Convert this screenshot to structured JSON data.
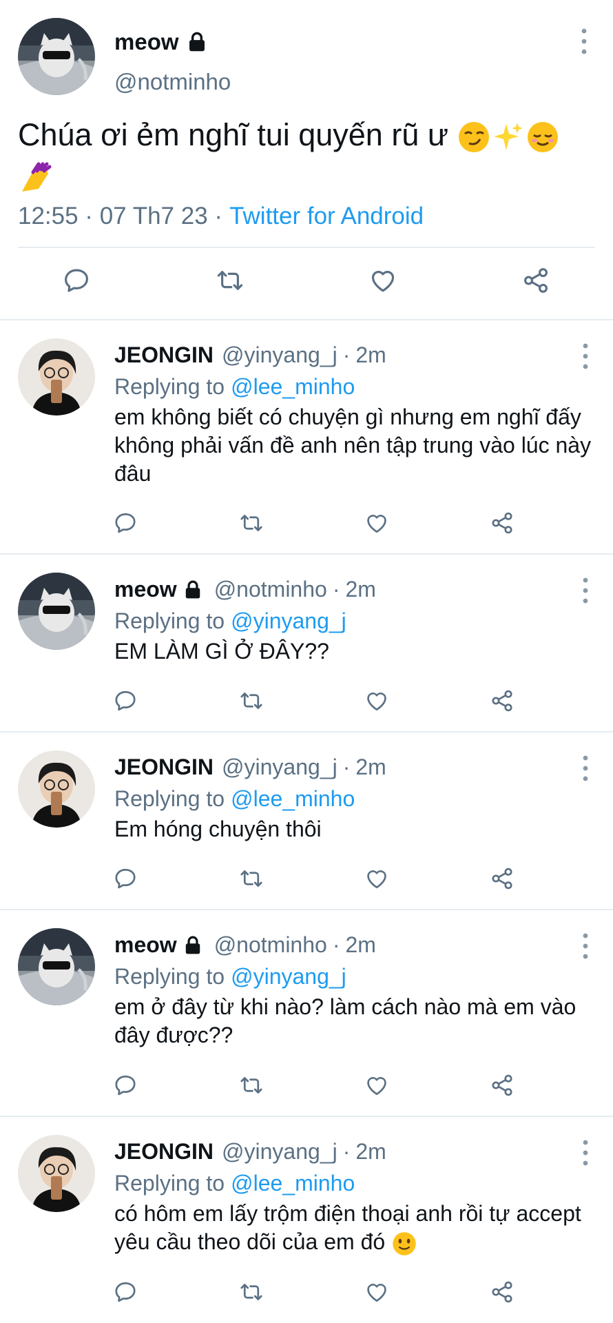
{
  "main_tweet": {
    "author_name": "meow",
    "author_handle": "@notminho",
    "locked_icon": "lock-icon",
    "text_line1": "Chúa ơi ẻm nghĩ tui quyến rũ ư",
    "emojis": [
      "smirking-face-icon",
      "sparkles-icon",
      "relieved-face-icon",
      "nail-polish-icon"
    ],
    "timestamp": "12:55 · 07 Th7 23 ·",
    "source": "Twitter for Android"
  },
  "replies": [
    {
      "author_name": "JEONGIN",
      "author_handle": "@yinyang_j",
      "time": "2m",
      "replying_label": "Replying to",
      "replying_to": "@lee_minho",
      "text": "em không biết có chuyện gì nhưng em nghĩ đấy không phải vấn đề anh nên tập trung vào lúc này đâu"
    },
    {
      "author_name": "meow",
      "author_handle": "@notminho",
      "time": "2m",
      "replying_label": "Replying to",
      "replying_to": "@yinyang_j",
      "text": "EM LÀM GÌ Ở ĐÂY??"
    },
    {
      "author_name": "JEONGIN",
      "author_handle": "@yinyang_j",
      "time": "2m",
      "replying_label": "Replying to",
      "replying_to": "@lee_minho",
      "text": "Em hóng chuyện thôi"
    },
    {
      "author_name": "meow",
      "author_handle": "@notminho",
      "time": "2m",
      "replying_label": "Replying to",
      "replying_to": "@yinyang_j",
      "text": "em ở đây từ khi nào? làm cách nào mà em vào đây được??"
    },
    {
      "author_name": "JEONGIN",
      "author_handle": "@yinyang_j",
      "time": "2m",
      "replying_label": "Replying to",
      "replying_to": "@lee_minho",
      "text": "có hôm em lấy trộm điện thoại anh rồi tự accept yêu cầu theo dõi của em đó"
    }
  ],
  "separator": "·",
  "colors": {
    "link": "#1d9bf0",
    "secondary": "#5b7083",
    "divider": "#e7ecf0",
    "icon": "#5b7083"
  },
  "action_icons": [
    "reply-icon",
    "retweet-icon",
    "like-icon",
    "share-icon"
  ]
}
